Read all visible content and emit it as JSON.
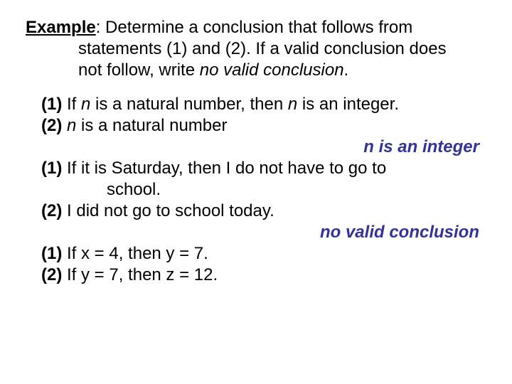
{
  "prompt": {
    "label": "Example",
    "line1": ":  Determine a conclusion that follows from",
    "line2": "statements (1) and (2).  If a valid conclusion does",
    "line3": "not follow, write ",
    "line3_ital": "no valid conclusion",
    "line3_end": "."
  },
  "p1": {
    "s1_num": "(1)",
    "s1_a": " If ",
    "s1_n1": "n",
    "s1_b": " is a natural number, then ",
    "s1_n2": "n",
    "s1_c": " is an integer.",
    "s2_num": "(2)",
    "s2_a": " ",
    "s2_n": "n",
    "s2_b": " is a natural number",
    "ans_a": "n",
    "ans_b": " is an integer"
  },
  "p2": {
    "s1_num": "(1)",
    "s1": " If it is Saturday, then I do not have to go to",
    "s1b": "school.",
    "s2_num": "(2)",
    "s2": " I did not go to school today.",
    "ans": "no valid conclusion"
  },
  "p3": {
    "s1_num": "(1)",
    "s1": " If x = 4, then y = 7.",
    "s2_num": "(2)",
    "s2": " If y = 7, then z = 12."
  }
}
